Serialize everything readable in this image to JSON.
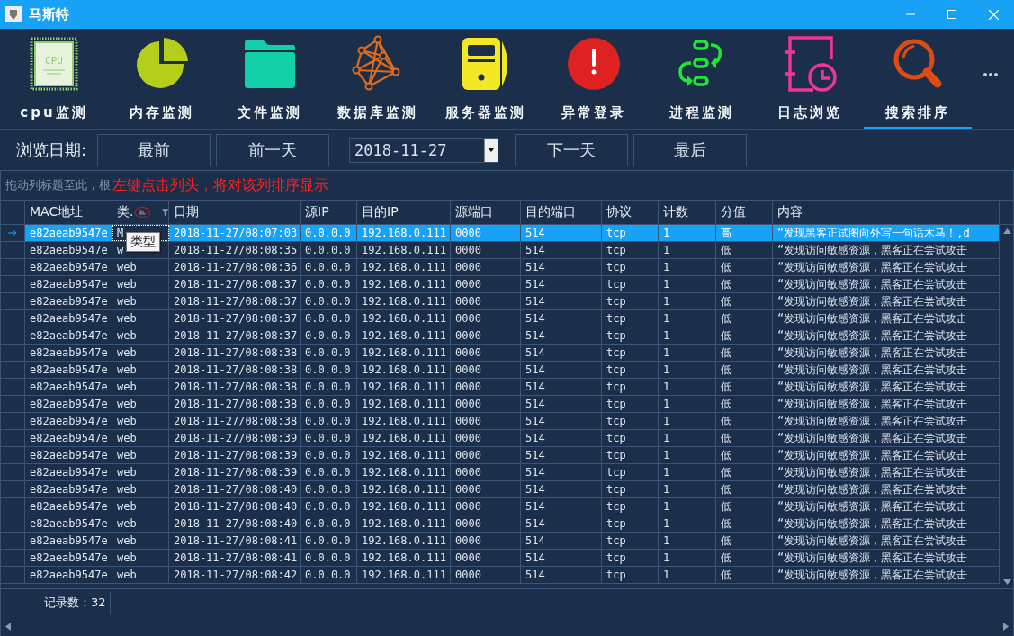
{
  "window": {
    "title": "马斯特"
  },
  "toolbar": {
    "items": [
      {
        "label": "cpu监测",
        "kind": "cpu",
        "chip_label": "CPU",
        "selected": false
      },
      {
        "label": "内存监测",
        "kind": "pie",
        "selected": false
      },
      {
        "label": "文件监测",
        "kind": "folder",
        "selected": false
      },
      {
        "label": "数据库监测",
        "kind": "network",
        "selected": false
      },
      {
        "label": "服务器监测",
        "kind": "server",
        "selected": false
      },
      {
        "label": "异常登录",
        "kind": "alert",
        "selected": false
      },
      {
        "label": "进程监测",
        "kind": "process",
        "selected": false
      },
      {
        "label": "日志浏览",
        "kind": "log",
        "selected": false
      },
      {
        "label": "搜索排序",
        "kind": "search",
        "selected": true
      }
    ]
  },
  "date_nav": {
    "label": "浏览日期:",
    "buttons_before": [
      "最前",
      "前一天"
    ],
    "date": "2018-11-27",
    "buttons_after": [
      "下一天",
      "最后"
    ]
  },
  "group_panel": {
    "hint": "拖动列标题至此，根",
    "instruction": "左键点击列头，将对该列排序显示"
  },
  "table": {
    "columns": [
      "MAC地址",
      "类.",
      "日期",
      "源IP",
      "目的IP",
      "源端口",
      "目的端口",
      "协议",
      "计数",
      "分值",
      "内容"
    ],
    "tooltip": "类型",
    "rows": [
      {
        "selected": true,
        "cells": [
          "e82aeab9547e",
          "M",
          "2018-11-27/08:07:03",
          "0.0.0.0",
          "192.168.0.111",
          "0000",
          "514",
          "tcp",
          "1",
          "高",
          "“发现黑客正试图向外写一句话木马！,d"
        ]
      },
      {
        "selected": false,
        "cells": [
          "e82aeab9547e",
          "w",
          "2018-11-27/08:08:35",
          "0.0.0.0",
          "192.168.0.111",
          "0000",
          "514",
          "tcp",
          "1",
          "低",
          "“发现访问敏感资源，黑客正在尝试攻击"
        ]
      },
      {
        "selected": false,
        "cells": [
          "e82aeab9547e",
          "web",
          "2018-11-27/08:08:36",
          "0.0.0.0",
          "192.168.0.111",
          "0000",
          "514",
          "tcp",
          "1",
          "低",
          "“发现访问敏感资源，黑客正在尝试攻击"
        ]
      },
      {
        "selected": false,
        "cells": [
          "e82aeab9547e",
          "web",
          "2018-11-27/08:08:37",
          "0.0.0.0",
          "192.168.0.111",
          "0000",
          "514",
          "tcp",
          "1",
          "低",
          "“发现访问敏感资源，黑客正在尝试攻击"
        ]
      },
      {
        "selected": false,
        "cells": [
          "e82aeab9547e",
          "web",
          "2018-11-27/08:08:37",
          "0.0.0.0",
          "192.168.0.111",
          "0000",
          "514",
          "tcp",
          "1",
          "低",
          "“发现访问敏感资源，黑客正在尝试攻击"
        ]
      },
      {
        "selected": false,
        "cells": [
          "e82aeab9547e",
          "web",
          "2018-11-27/08:08:37",
          "0.0.0.0",
          "192.168.0.111",
          "0000",
          "514",
          "tcp",
          "1",
          "低",
          "“发现访问敏感资源，黑客正在尝试攻击"
        ]
      },
      {
        "selected": false,
        "cells": [
          "e82aeab9547e",
          "web",
          "2018-11-27/08:08:37",
          "0.0.0.0",
          "192.168.0.111",
          "0000",
          "514",
          "tcp",
          "1",
          "低",
          "“发现访问敏感资源，黑客正在尝试攻击"
        ]
      },
      {
        "selected": false,
        "cells": [
          "e82aeab9547e",
          "web",
          "2018-11-27/08:08:38",
          "0.0.0.0",
          "192.168.0.111",
          "0000",
          "514",
          "tcp",
          "1",
          "低",
          "“发现访问敏感资源，黑客正在尝试攻击"
        ]
      },
      {
        "selected": false,
        "cells": [
          "e82aeab9547e",
          "web",
          "2018-11-27/08:08:38",
          "0.0.0.0",
          "192.168.0.111",
          "0000",
          "514",
          "tcp",
          "1",
          "低",
          "“发现访问敏感资源，黑客正在尝试攻击"
        ]
      },
      {
        "selected": false,
        "cells": [
          "e82aeab9547e",
          "web",
          "2018-11-27/08:08:38",
          "0.0.0.0",
          "192.168.0.111",
          "0000",
          "514",
          "tcp",
          "1",
          "低",
          "“发现访问敏感资源，黑客正在尝试攻击"
        ]
      },
      {
        "selected": false,
        "cells": [
          "e82aeab9547e",
          "web",
          "2018-11-27/08:08:38",
          "0.0.0.0",
          "192.168.0.111",
          "0000",
          "514",
          "tcp",
          "1",
          "低",
          "“发现访问敏感资源，黑客正在尝试攻击"
        ]
      },
      {
        "selected": false,
        "cells": [
          "e82aeab9547e",
          "web",
          "2018-11-27/08:08:38",
          "0.0.0.0",
          "192.168.0.111",
          "0000",
          "514",
          "tcp",
          "1",
          "低",
          "“发现访问敏感资源，黑客正在尝试攻击"
        ]
      },
      {
        "selected": false,
        "cells": [
          "e82aeab9547e",
          "web",
          "2018-11-27/08:08:39",
          "0.0.0.0",
          "192.168.0.111",
          "0000",
          "514",
          "tcp",
          "1",
          "低",
          "“发现访问敏感资源，黑客正在尝试攻击"
        ]
      },
      {
        "selected": false,
        "cells": [
          "e82aeab9547e",
          "web",
          "2018-11-27/08:08:39",
          "0.0.0.0",
          "192.168.0.111",
          "0000",
          "514",
          "tcp",
          "1",
          "低",
          "“发现访问敏感资源，黑客正在尝试攻击"
        ]
      },
      {
        "selected": false,
        "cells": [
          "e82aeab9547e",
          "web",
          "2018-11-27/08:08:39",
          "0.0.0.0",
          "192.168.0.111",
          "0000",
          "514",
          "tcp",
          "1",
          "低",
          "“发现访问敏感资源，黑客正在尝试攻击"
        ]
      },
      {
        "selected": false,
        "cells": [
          "e82aeab9547e",
          "web",
          "2018-11-27/08:08:40",
          "0.0.0.0",
          "192.168.0.111",
          "0000",
          "514",
          "tcp",
          "1",
          "低",
          "“发现访问敏感资源，黑客正在尝试攻击"
        ]
      },
      {
        "selected": false,
        "cells": [
          "e82aeab9547e",
          "web",
          "2018-11-27/08:08:40",
          "0.0.0.0",
          "192.168.0.111",
          "0000",
          "514",
          "tcp",
          "1",
          "低",
          "“发现访问敏感资源，黑客正在尝试攻击"
        ]
      },
      {
        "selected": false,
        "cells": [
          "e82aeab9547e",
          "web",
          "2018-11-27/08:08:40",
          "0.0.0.0",
          "192.168.0.111",
          "0000",
          "514",
          "tcp",
          "1",
          "低",
          "“发现访问敏感资源，黑客正在尝试攻击"
        ]
      },
      {
        "selected": false,
        "cells": [
          "e82aeab9547e",
          "web",
          "2018-11-27/08:08:41",
          "0.0.0.0",
          "192.168.0.111",
          "0000",
          "514",
          "tcp",
          "1",
          "低",
          "“发现访问敏感资源，黑客正在尝试攻击"
        ]
      },
      {
        "selected": false,
        "cells": [
          "e82aeab9547e",
          "web",
          "2018-11-27/08:08:41",
          "0.0.0.0",
          "192.168.0.111",
          "0000",
          "514",
          "tcp",
          "1",
          "低",
          "“发现访问敏感资源，黑客正在尝试攻击"
        ]
      },
      {
        "selected": false,
        "cells": [
          "e82aeab9547e",
          "web",
          "2018-11-27/08:08:42",
          "0.0.0.0",
          "192.168.0.111",
          "0000",
          "514",
          "tcp",
          "1",
          "低",
          "“发现访问敏感资源，黑客正在尝试攻击"
        ]
      }
    ]
  },
  "status_bar": {
    "record_count": "记录数：32"
  }
}
